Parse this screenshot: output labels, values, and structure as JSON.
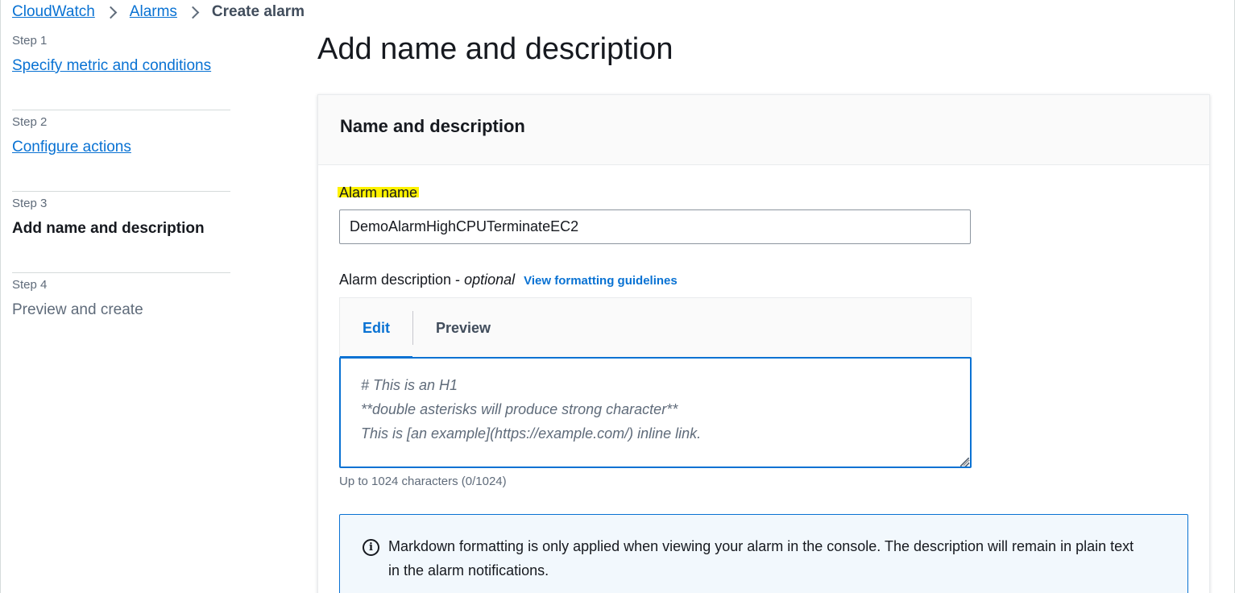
{
  "breadcrumb": {
    "items": [
      "CloudWatch",
      "Alarms"
    ],
    "current": "Create alarm"
  },
  "steps": [
    {
      "number": "Step 1",
      "title": "Specify metric and conditions",
      "state": "link"
    },
    {
      "number": "Step 2",
      "title": "Configure actions",
      "state": "link"
    },
    {
      "number": "Step 3",
      "title": "Add name and description",
      "state": "active"
    },
    {
      "number": "Step 4",
      "title": "Preview and create",
      "state": "disabled"
    }
  ],
  "page": {
    "title": "Add name and description"
  },
  "container": {
    "header": "Name and description",
    "alarm_name": {
      "label": "Alarm name",
      "value": "DemoAlarmHighCPUTerminateEC2"
    },
    "alarm_description": {
      "label": "Alarm description - ",
      "optional": "optional",
      "guidelines_link": "View formatting guidelines",
      "tabs": [
        "Edit",
        "Preview"
      ],
      "active_tab": "Edit",
      "placeholder_lines": [
        "# This is an H1",
        "**double asterisks will produce strong character**",
        "This is [an example](https://example.com/) inline link."
      ],
      "value": "",
      "constraint": "Up to 1024 characters (0/1024)"
    },
    "info_alert": {
      "icon": "info-icon",
      "text": "Markdown formatting is only applied when viewing your alarm in the console. The description will remain in plain text in the alarm notifications."
    }
  },
  "colors": {
    "link": "#0972d3",
    "highlight": "#fff200",
    "info_background": "#f2f8fd"
  }
}
